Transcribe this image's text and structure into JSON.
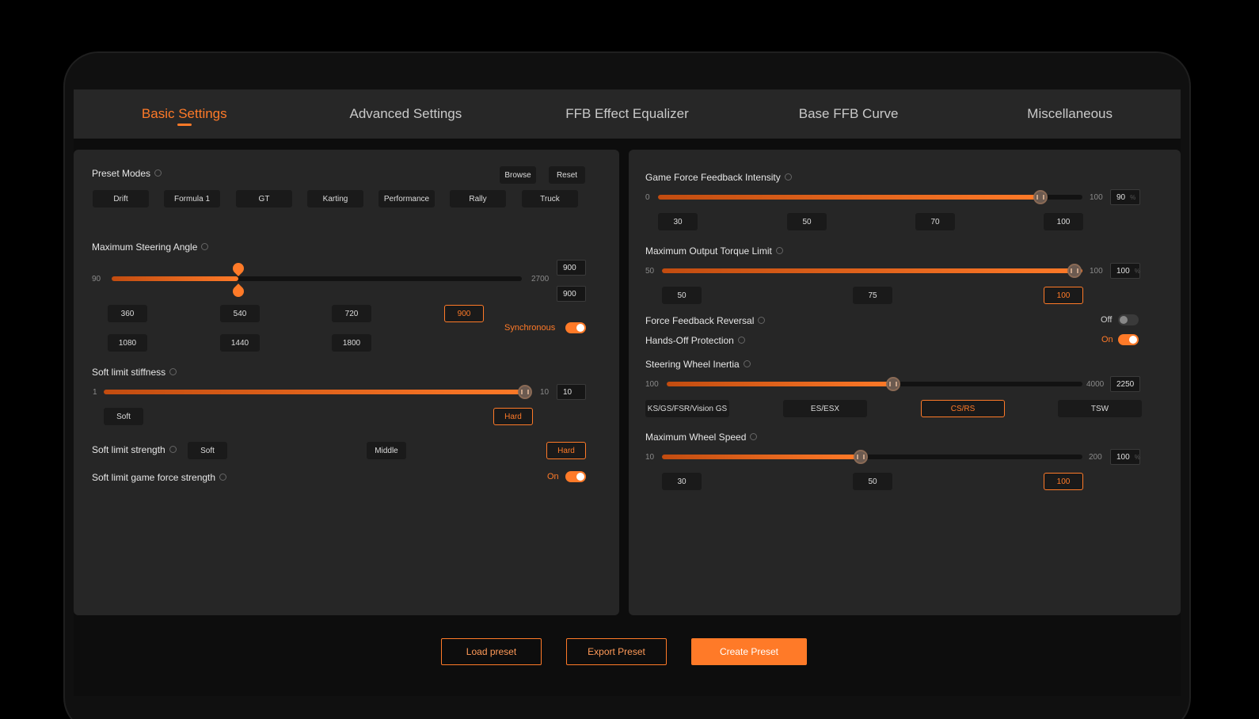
{
  "tabs": [
    "Basic Settings",
    "Advanced Settings",
    "FFB Effect Equalizer",
    "Base FFB Curve",
    "Miscellaneous"
  ],
  "active_tab": "Basic Settings",
  "left": {
    "preset_modes": {
      "label": "Preset Modes",
      "browse": "Browse",
      "reset": "Reset",
      "modes": [
        "Drift",
        "Formula 1",
        "GT",
        "Karting",
        "Performance",
        "Rally",
        "Truck"
      ]
    },
    "steering_angle": {
      "label": "Maximum Steering Angle",
      "min": "90",
      "max": "2700",
      "value_top": "900",
      "value_bottom": "900",
      "level": 0.31,
      "presets": [
        "360",
        "540",
        "720",
        "900",
        "1080",
        "1440",
        "1800"
      ],
      "selected": "900",
      "synchronous_label": "Synchronous",
      "synchronous_on": true
    },
    "soft_limit_stiffness": {
      "label": "Soft limit stiffness",
      "min": "1",
      "max": "10",
      "value": "10",
      "level": 1.0,
      "soft": "Soft",
      "hard": "Hard"
    },
    "soft_limit_strength": {
      "label": "Soft limit strength",
      "options": [
        "Soft",
        "Middle",
        "Hard"
      ],
      "selected": "Hard"
    },
    "soft_limit_game_force": {
      "label": "Soft limit game force strength",
      "state": "On"
    }
  },
  "right": {
    "game_ffb_intensity": {
      "label": "Game Force Feedback Intensity",
      "min": "0",
      "max": "100",
      "value": "90",
      "unit": "%",
      "level": 0.9,
      "presets": [
        "30",
        "50",
        "70",
        "100"
      ]
    },
    "max_output_torque": {
      "label": "Maximum Output Torque Limit",
      "min": "50",
      "max": "100",
      "value": "100",
      "unit": "%",
      "level": 1.0,
      "presets": [
        "50",
        "75",
        "100"
      ],
      "selected": "100"
    },
    "ffb_reversal": {
      "label": "Force Feedback Reversal",
      "state": "Off"
    },
    "hands_off": {
      "label": "Hands-Off Protection",
      "state": "On"
    },
    "wheel_inertia": {
      "label": "Steering Wheel Inertia",
      "min": "100",
      "max": "4000",
      "value": "2250",
      "level": 0.55,
      "presets": [
        "KS/GS/FSR/Vision GS",
        "ES/ESX",
        "CS/RS",
        "TSW"
      ],
      "selected": "CS/RS"
    },
    "max_wheel_speed": {
      "label": "Maximum Wheel Speed",
      "min": "10",
      "max": "200",
      "value": "100",
      "unit": "%",
      "level": 0.47,
      "presets": [
        "30",
        "50",
        "100"
      ],
      "selected": "100"
    }
  },
  "footer": {
    "load": "Load preset",
    "export": "Export Preset",
    "create": "Create Preset"
  },
  "colors": {
    "accent": "#ff7a28",
    "panel": "#262626",
    "chip": "#1a1a1a"
  }
}
